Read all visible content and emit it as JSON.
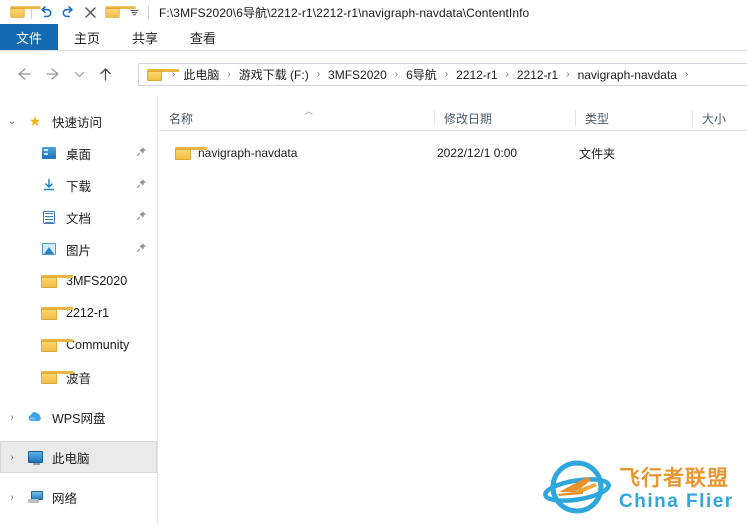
{
  "window": {
    "title_path": "F:\\3MFS2020\\6导航\\2212-r1\\2212-r1\\navigraph-navdata\\ContentInfo"
  },
  "quick_access_toolbar": {
    "items": [
      {
        "name": "properties-folder-icon",
        "glyph": "folder"
      },
      {
        "name": "undo-icon",
        "glyph": "↺"
      },
      {
        "name": "redo-icon",
        "glyph": "↻"
      },
      {
        "name": "delete-icon",
        "glyph": "✕"
      },
      {
        "name": "new-folder-icon",
        "glyph": "folder"
      },
      {
        "name": "customize-dropdown-icon",
        "glyph": "▾"
      }
    ]
  },
  "ribbon": {
    "tabs": [
      {
        "label": "文件",
        "selected": true
      },
      {
        "label": "主页",
        "selected": false
      },
      {
        "label": "共享",
        "selected": false
      },
      {
        "label": "查看",
        "selected": false
      }
    ]
  },
  "navigation": {
    "back": "←",
    "forward": "→",
    "recent": "⌄",
    "up": "↑"
  },
  "breadcrumb": {
    "separator": "›",
    "items": [
      "此电脑",
      "游戏下载 (F:)",
      "3MFS2020",
      "6导航",
      "2212-r1",
      "2212-r1",
      "navigraph-navdata"
    ]
  },
  "columns": [
    {
      "label": "名称",
      "sorted": "asc"
    },
    {
      "label": "修改日期",
      "sorted": ""
    },
    {
      "label": "类型",
      "sorted": ""
    },
    {
      "label": "大小",
      "sorted": ""
    }
  ],
  "sort_caret": "︿",
  "files": [
    {
      "name": "navigraph-navdata",
      "modified": "2022/12/1 0:00",
      "type": "文件夹",
      "size": "",
      "icon": "folder-icon"
    }
  ],
  "sidebar": {
    "items": [
      {
        "label": "快速访问",
        "icon": "star-icon",
        "chevron": "⌄",
        "pinned": false,
        "level": 0,
        "selected": false
      },
      {
        "label": "桌面",
        "icon": "desktop-icon",
        "chevron": "",
        "pinned": true,
        "level": 1,
        "selected": false
      },
      {
        "label": "下载",
        "icon": "download-icon",
        "chevron": "",
        "pinned": true,
        "level": 1,
        "selected": false
      },
      {
        "label": "文档",
        "icon": "document-icon",
        "chevron": "",
        "pinned": true,
        "level": 1,
        "selected": false
      },
      {
        "label": "图片",
        "icon": "pictures-icon",
        "chevron": "",
        "pinned": true,
        "level": 1,
        "selected": false
      },
      {
        "label": "3MFS2020",
        "icon": "folder-icon",
        "chevron": "",
        "pinned": false,
        "level": 1,
        "selected": false
      },
      {
        "label": "2212-r1",
        "icon": "folder-icon",
        "chevron": "",
        "pinned": false,
        "level": 1,
        "selected": false
      },
      {
        "label": "Community",
        "icon": "folder-icon",
        "chevron": "",
        "pinned": false,
        "level": 1,
        "selected": false
      },
      {
        "label": "波音",
        "icon": "folder-icon",
        "chevron": "",
        "pinned": false,
        "level": 1,
        "selected": false
      },
      {
        "label": "WPS网盘",
        "icon": "cloud-icon",
        "chevron": "›",
        "pinned": false,
        "level": 0,
        "selected": false
      },
      {
        "label": "此电脑",
        "icon": "this-pc-icon",
        "chevron": "›",
        "pinned": false,
        "level": 0,
        "selected": true
      },
      {
        "label": "网络",
        "icon": "network-icon",
        "chevron": "›",
        "pinned": false,
        "level": 0,
        "selected": false
      }
    ],
    "pin_glyph": "📌"
  },
  "watermark": {
    "chinese": "飞行者联盟",
    "english": "China Flier",
    "accent_blue": "#2fa7dc",
    "accent_orange": "#e8972e"
  },
  "colors": {
    "file_tab_blue": "#1569b0",
    "selection_gray": "#eaeaea",
    "header_text": "#4a5a6a",
    "folder_yellow": "#f3bd45"
  }
}
